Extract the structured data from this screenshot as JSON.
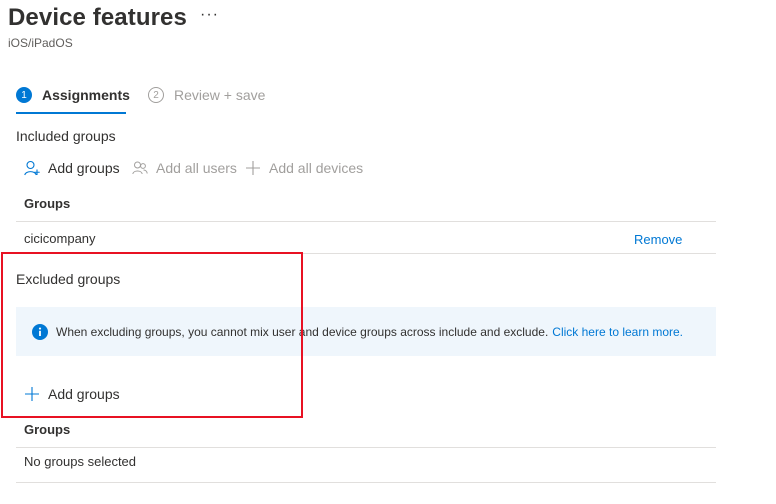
{
  "header": {
    "title": "Device features",
    "more_label": "···",
    "subtitle": "iOS/iPadOS"
  },
  "steps": [
    {
      "number": "1",
      "label": "Assignments",
      "active": true
    },
    {
      "number": "2",
      "label": "Review + save",
      "active": false
    }
  ],
  "included": {
    "section_title": "Included groups",
    "commands": {
      "add_groups": "Add groups",
      "add_all_users": "Add all users",
      "add_all_devices": "Add all devices"
    },
    "table": {
      "column_header": "Groups",
      "rows": [
        {
          "name": "cicicompany",
          "action": "Remove"
        }
      ]
    }
  },
  "excluded": {
    "section_title": "Excluded groups",
    "info": {
      "text": "When excluding groups, you cannot mix user and device groups across include and exclude.",
      "link": "Click here to learn more."
    },
    "commands": {
      "add_groups": "Add groups"
    },
    "table": {
      "column_header": "Groups",
      "empty_text": "No groups selected"
    }
  },
  "colors": {
    "accent": "#0078d4",
    "highlight_box": "#e81123",
    "info_background": "#eff6fc"
  }
}
